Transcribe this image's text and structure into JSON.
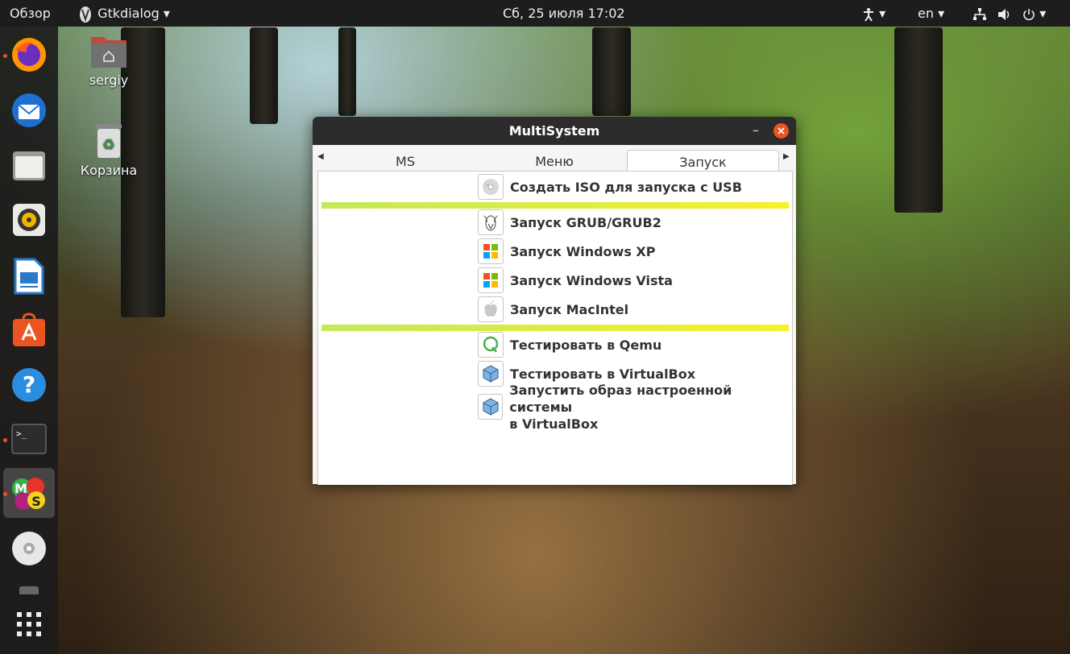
{
  "topbar": {
    "activities": "Обзор",
    "app_name": "Gtkdialog",
    "datetime": "Сб, 25 июля  17:02",
    "keyboard_layout": "en"
  },
  "dock": {
    "items": [
      "firefox-icon",
      "thunderbird-icon",
      "files-icon",
      "rhythmbox-icon",
      "writer-icon",
      "software-icon",
      "help-icon",
      "terminal-icon",
      "multisystem-icon",
      "cd-drive-icon",
      "show-apps-icon"
    ]
  },
  "desktop": {
    "home_label": "sergiy",
    "trash_label": "Корзина"
  },
  "window": {
    "title": "MultiSystem",
    "tabs": [
      "MS",
      "Меню",
      "Запуск"
    ],
    "active_tab": "Запуск",
    "items": [
      {
        "label": "Создать ISO для запуска с USB",
        "icon": "cd-icon"
      },
      {
        "label": "Запуск GRUB/GRUB2",
        "icon": "gnu-icon"
      },
      {
        "label": "Запуск Windows XP",
        "icon": "windows-icon"
      },
      {
        "label": "Запуск Windows Vista",
        "icon": "windows-icon"
      },
      {
        "label": "Запуск MacIntel",
        "icon": "apple-icon"
      },
      {
        "label": "Тестировать в Qemu",
        "icon": "qemu-icon"
      },
      {
        "label": "Тестировать в VirtualBox",
        "icon": "virtualbox-icon"
      },
      {
        "label": "Запустить образ настроенной системы",
        "label2": "в VirtualBox",
        "icon": "virtualbox-icon"
      }
    ]
  },
  "colors": {
    "accent": "#e95420",
    "separator_start": "#c4e85a",
    "separator_end": "#f6f12a",
    "titlebar": "#2c2c2c",
    "close_button": "#e95420"
  }
}
